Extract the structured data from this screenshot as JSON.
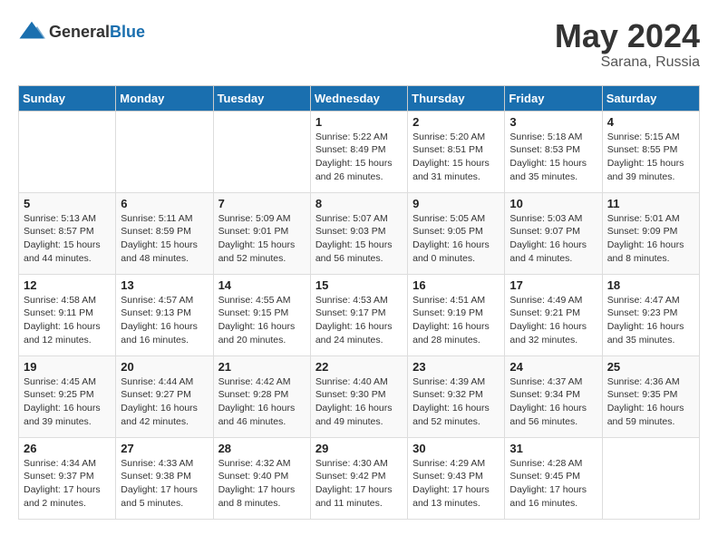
{
  "header": {
    "logo_general": "General",
    "logo_blue": "Blue",
    "month_year": "May 2024",
    "location": "Sarana, Russia"
  },
  "weekdays": [
    "Sunday",
    "Monday",
    "Tuesday",
    "Wednesday",
    "Thursday",
    "Friday",
    "Saturday"
  ],
  "weeks": [
    [
      {
        "day": "",
        "sunrise": "",
        "sunset": "",
        "daylight": ""
      },
      {
        "day": "",
        "sunrise": "",
        "sunset": "",
        "daylight": ""
      },
      {
        "day": "",
        "sunrise": "",
        "sunset": "",
        "daylight": ""
      },
      {
        "day": "1",
        "sunrise": "Sunrise: 5:22 AM",
        "sunset": "Sunset: 8:49 PM",
        "daylight": "Daylight: 15 hours and 26 minutes."
      },
      {
        "day": "2",
        "sunrise": "Sunrise: 5:20 AM",
        "sunset": "Sunset: 8:51 PM",
        "daylight": "Daylight: 15 hours and 31 minutes."
      },
      {
        "day": "3",
        "sunrise": "Sunrise: 5:18 AM",
        "sunset": "Sunset: 8:53 PM",
        "daylight": "Daylight: 15 hours and 35 minutes."
      },
      {
        "day": "4",
        "sunrise": "Sunrise: 5:15 AM",
        "sunset": "Sunset: 8:55 PM",
        "daylight": "Daylight: 15 hours and 39 minutes."
      }
    ],
    [
      {
        "day": "5",
        "sunrise": "Sunrise: 5:13 AM",
        "sunset": "Sunset: 8:57 PM",
        "daylight": "Daylight: 15 hours and 44 minutes."
      },
      {
        "day": "6",
        "sunrise": "Sunrise: 5:11 AM",
        "sunset": "Sunset: 8:59 PM",
        "daylight": "Daylight: 15 hours and 48 minutes."
      },
      {
        "day": "7",
        "sunrise": "Sunrise: 5:09 AM",
        "sunset": "Sunset: 9:01 PM",
        "daylight": "Daylight: 15 hours and 52 minutes."
      },
      {
        "day": "8",
        "sunrise": "Sunrise: 5:07 AM",
        "sunset": "Sunset: 9:03 PM",
        "daylight": "Daylight: 15 hours and 56 minutes."
      },
      {
        "day": "9",
        "sunrise": "Sunrise: 5:05 AM",
        "sunset": "Sunset: 9:05 PM",
        "daylight": "Daylight: 16 hours and 0 minutes."
      },
      {
        "day": "10",
        "sunrise": "Sunrise: 5:03 AM",
        "sunset": "Sunset: 9:07 PM",
        "daylight": "Daylight: 16 hours and 4 minutes."
      },
      {
        "day": "11",
        "sunrise": "Sunrise: 5:01 AM",
        "sunset": "Sunset: 9:09 PM",
        "daylight": "Daylight: 16 hours and 8 minutes."
      }
    ],
    [
      {
        "day": "12",
        "sunrise": "Sunrise: 4:58 AM",
        "sunset": "Sunset: 9:11 PM",
        "daylight": "Daylight: 16 hours and 12 minutes."
      },
      {
        "day": "13",
        "sunrise": "Sunrise: 4:57 AM",
        "sunset": "Sunset: 9:13 PM",
        "daylight": "Daylight: 16 hours and 16 minutes."
      },
      {
        "day": "14",
        "sunrise": "Sunrise: 4:55 AM",
        "sunset": "Sunset: 9:15 PM",
        "daylight": "Daylight: 16 hours and 20 minutes."
      },
      {
        "day": "15",
        "sunrise": "Sunrise: 4:53 AM",
        "sunset": "Sunset: 9:17 PM",
        "daylight": "Daylight: 16 hours and 24 minutes."
      },
      {
        "day": "16",
        "sunrise": "Sunrise: 4:51 AM",
        "sunset": "Sunset: 9:19 PM",
        "daylight": "Daylight: 16 hours and 28 minutes."
      },
      {
        "day": "17",
        "sunrise": "Sunrise: 4:49 AM",
        "sunset": "Sunset: 9:21 PM",
        "daylight": "Daylight: 16 hours and 32 minutes."
      },
      {
        "day": "18",
        "sunrise": "Sunrise: 4:47 AM",
        "sunset": "Sunset: 9:23 PM",
        "daylight": "Daylight: 16 hours and 35 minutes."
      }
    ],
    [
      {
        "day": "19",
        "sunrise": "Sunrise: 4:45 AM",
        "sunset": "Sunset: 9:25 PM",
        "daylight": "Daylight: 16 hours and 39 minutes."
      },
      {
        "day": "20",
        "sunrise": "Sunrise: 4:44 AM",
        "sunset": "Sunset: 9:27 PM",
        "daylight": "Daylight: 16 hours and 42 minutes."
      },
      {
        "day": "21",
        "sunrise": "Sunrise: 4:42 AM",
        "sunset": "Sunset: 9:28 PM",
        "daylight": "Daylight: 16 hours and 46 minutes."
      },
      {
        "day": "22",
        "sunrise": "Sunrise: 4:40 AM",
        "sunset": "Sunset: 9:30 PM",
        "daylight": "Daylight: 16 hours and 49 minutes."
      },
      {
        "day": "23",
        "sunrise": "Sunrise: 4:39 AM",
        "sunset": "Sunset: 9:32 PM",
        "daylight": "Daylight: 16 hours and 52 minutes."
      },
      {
        "day": "24",
        "sunrise": "Sunrise: 4:37 AM",
        "sunset": "Sunset: 9:34 PM",
        "daylight": "Daylight: 16 hours and 56 minutes."
      },
      {
        "day": "25",
        "sunrise": "Sunrise: 4:36 AM",
        "sunset": "Sunset: 9:35 PM",
        "daylight": "Daylight: 16 hours and 59 minutes."
      }
    ],
    [
      {
        "day": "26",
        "sunrise": "Sunrise: 4:34 AM",
        "sunset": "Sunset: 9:37 PM",
        "daylight": "Daylight: 17 hours and 2 minutes."
      },
      {
        "day": "27",
        "sunrise": "Sunrise: 4:33 AM",
        "sunset": "Sunset: 9:38 PM",
        "daylight": "Daylight: 17 hours and 5 minutes."
      },
      {
        "day": "28",
        "sunrise": "Sunrise: 4:32 AM",
        "sunset": "Sunset: 9:40 PM",
        "daylight": "Daylight: 17 hours and 8 minutes."
      },
      {
        "day": "29",
        "sunrise": "Sunrise: 4:30 AM",
        "sunset": "Sunset: 9:42 PM",
        "daylight": "Daylight: 17 hours and 11 minutes."
      },
      {
        "day": "30",
        "sunrise": "Sunrise: 4:29 AM",
        "sunset": "Sunset: 9:43 PM",
        "daylight": "Daylight: 17 hours and 13 minutes."
      },
      {
        "day": "31",
        "sunrise": "Sunrise: 4:28 AM",
        "sunset": "Sunset: 9:45 PM",
        "daylight": "Daylight: 17 hours and 16 minutes."
      },
      {
        "day": "",
        "sunrise": "",
        "sunset": "",
        "daylight": ""
      }
    ]
  ]
}
